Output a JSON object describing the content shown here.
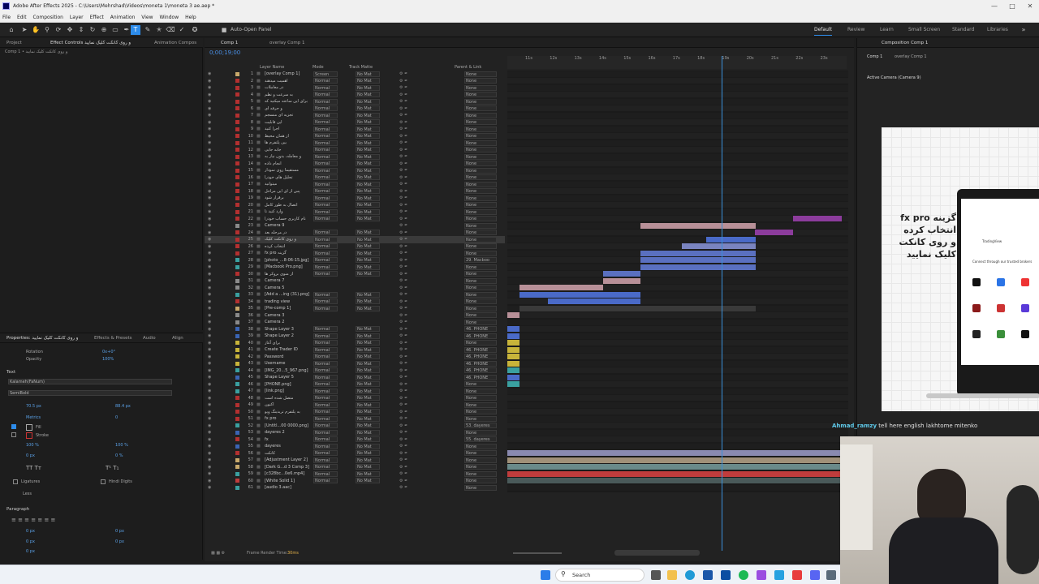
{
  "window": {
    "title": "Adobe After Effects 2025 - C:\\Users\\Mehrshad\\Videos\\moneta 1\\moneta 3 ae.aep *"
  },
  "menu": [
    "File",
    "Edit",
    "Composition",
    "Layer",
    "Effect",
    "Animation",
    "View",
    "Window",
    "Help"
  ],
  "toolbar": {
    "auto_open": "Auto-Open Panel"
  },
  "workspaces": [
    "Default",
    "Review",
    "Learn",
    "Small Screen",
    "Standard",
    "Libraries"
  ],
  "project_panel": {
    "tab_project": "Project",
    "tab_effects": "Effect Controls و روی کانکت کلیک نمایید",
    "tab_anim": "Animation Compos",
    "subtitle": "Comp 1 • و روی کانکت کلیک نمایید"
  },
  "timeline": {
    "tabs": [
      "Comp 1",
      "overlay Comp 1"
    ],
    "timecode": "0;00;19;00",
    "col_layer": "Layer Name",
    "col_mode": "Mode",
    "col_track": "Track Matte",
    "col_parent": "Parent & Link",
    "ruler": [
      "11s",
      "12s",
      "13s",
      "14s",
      "15s",
      "16s",
      "17s",
      "18s",
      "19s",
      "20s",
      "21s",
      "22s",
      "23s"
    ],
    "footer": "Frame Render Time:",
    "footer_val": "30ms"
  },
  "layers": [
    {
      "n": "1",
      "name": "[overlay Comp 1]",
      "mode": "Screen",
      "matte": "No Mat",
      "parent": "None",
      "color": "#c8a96b"
    },
    {
      "n": "2",
      "name": "اهمیت میدهند",
      "mode": "Normal",
      "matte": "No Mat",
      "parent": "None",
      "color": "#b33030"
    },
    {
      "n": "3",
      "name": "در معاملات",
      "mode": "Normal",
      "matte": "No Mat",
      "parent": "None",
      "color": "#b33030"
    },
    {
      "n": "4",
      "name": "به سرعت و نظم",
      "mode": "Normal",
      "matte": "No Mat",
      "parent": "None",
      "color": "#b33030"
    },
    {
      "n": "5",
      "name": "برای این ساعته میکنید که",
      "mode": "Normal",
      "matte": "No Mat",
      "parent": "None",
      "color": "#b33030"
    },
    {
      "n": "6",
      "name": "و حرفه ای",
      "mode": "Normal",
      "matte": "No Mat",
      "parent": "None",
      "color": "#b33030"
    },
    {
      "n": "7",
      "name": "تجزیه ای منسجم",
      "mode": "Normal",
      "matte": "No Mat",
      "parent": "None",
      "color": "#b33030"
    },
    {
      "n": "8",
      "name": "این قابلیت",
      "mode": "Normal",
      "matte": "No Mat",
      "parent": "None",
      "color": "#b33030"
    },
    {
      "n": "9",
      "name": "اجرا کنید",
      "mode": "Normal",
      "matte": "No Mat",
      "parent": "None",
      "color": "#b33030"
    },
    {
      "n": "10",
      "name": "از همان محیط",
      "mode": "Normal",
      "matte": "No Mat",
      "parent": "None",
      "color": "#b33030"
    },
    {
      "n": "11",
      "name": "بین پلتفرم ها",
      "mode": "Normal",
      "matte": "No Mat",
      "parent": "None",
      "color": "#b33030"
    },
    {
      "n": "12",
      "name": "جابه جایی",
      "mode": "Normal",
      "matte": "No Mat",
      "parent": "None",
      "color": "#b33030"
    },
    {
      "n": "13",
      "name": "و معامله، بدون نیاز به",
      "mode": "Normal",
      "matte": "No Mat",
      "parent": "None",
      "color": "#b33030"
    },
    {
      "n": "14",
      "name": "انجام داده",
      "mode": "Normal",
      "matte": "No Mat",
      "parent": "None",
      "color": "#b33030"
    },
    {
      "n": "15",
      "name": "مستقیما روی نمودار",
      "mode": "Normal",
      "matte": "No Mat",
      "parent": "None",
      "color": "#b33030"
    },
    {
      "n": "16",
      "name": "تحلیل های خودرا",
      "mode": "Normal",
      "matte": "No Mat",
      "parent": "None",
      "color": "#b33030"
    },
    {
      "n": "17",
      "name": "میتوانید",
      "mode": "Normal",
      "matte": "No Mat",
      "parent": "None",
      "color": "#b33030"
    },
    {
      "n": "18",
      "name": "پس از ای این مراحل",
      "mode": "Normal",
      "matte": "No Mat",
      "parent": "None",
      "color": "#b33030"
    },
    {
      "n": "19",
      "name": "برقرار شود",
      "mode": "Normal",
      "matte": "No Mat",
      "parent": "None",
      "color": "#b33030"
    },
    {
      "n": "20",
      "name": "اتصال به طور کامل",
      "mode": "Normal",
      "matte": "No Mat",
      "parent": "None",
      "color": "#b33030"
    },
    {
      "n": "21",
      "name": "وارد کنید تا",
      "mode": "Normal",
      "matte": "No Mat",
      "parent": "None",
      "color": "#b33030"
    },
    {
      "n": "22",
      "name": "نام کاربری حساب خودرا",
      "mode": "Normal",
      "matte": "No Mat",
      "parent": "None",
      "color": "#b33030"
    },
    {
      "n": "23",
      "name": "Camera 9",
      "mode": "",
      "matte": "",
      "parent": "None",
      "color": "#8a8a8a"
    },
    {
      "n": "24",
      "name": "در مرحله بعد",
      "mode": "Normal",
      "matte": "No Mat",
      "parent": "None",
      "color": "#b33030"
    },
    {
      "n": "25",
      "name": "و روی کانکت کلیک",
      "mode": "Normal",
      "matte": "No Mat",
      "parent": "None",
      "color": "#b33030"
    },
    {
      "n": "26",
      "name": "انتخاب کرده",
      "mode": "Normal",
      "matte": "No Mat",
      "parent": "None",
      "color": "#b33030"
    },
    {
      "n": "27",
      "name": "fx pro گزینه",
      "mode": "Normal",
      "matte": "No Mat",
      "parent": "None",
      "color": "#b33030"
    },
    {
      "n": "28",
      "name": "[photo_...8-06-15.jpg]",
      "mode": "Normal",
      "matte": "No Mat",
      "parent": "29. Macboo",
      "color": "#3aa0a0"
    },
    {
      "n": "29",
      "name": "[Macbook Pro.png]",
      "mode": "Normal",
      "matte": "No Mat",
      "parent": "None",
      "color": "#3aa0a0"
    },
    {
      "n": "30",
      "name": "از منوی بروکر ها",
      "mode": "Normal",
      "matte": "No Mat",
      "parent": "None",
      "color": "#b33030"
    },
    {
      "n": "31",
      "name": "Camera 7",
      "mode": "",
      "matte": "",
      "parent": "None",
      "color": "#8a8a8a"
    },
    {
      "n": "32",
      "name": "Camera 5",
      "mode": "",
      "matte": "",
      "parent": "None",
      "color": "#8a8a8a"
    },
    {
      "n": "33",
      "name": "[Add a ...ing (31).png]",
      "mode": "Normal",
      "matte": "No Mat",
      "parent": "None",
      "color": "#3aa0a0"
    },
    {
      "n": "34",
      "name": "trading view",
      "mode": "Normal",
      "matte": "No Mat",
      "parent": "None",
      "color": "#b33030"
    },
    {
      "n": "35",
      "name": "[Pre-comp 1]",
      "mode": "Normal",
      "matte": "No Mat",
      "parent": "None",
      "color": "#c8a96b"
    },
    {
      "n": "36",
      "name": "Camera 3",
      "mode": "",
      "matte": "",
      "parent": "None",
      "color": "#8a8a8a"
    },
    {
      "n": "37",
      "name": "Camera 2",
      "mode": "",
      "matte": "",
      "parent": "None",
      "color": "#8a8a8a"
    },
    {
      "n": "38",
      "name": "Shape Layer 3",
      "mode": "Normal",
      "matte": "No Mat",
      "parent": "46. PHONE_",
      "color": "#3a64b4"
    },
    {
      "n": "39",
      "name": "Shape Layer 2",
      "mode": "Normal",
      "matte": "No Mat",
      "parent": "46. PHONE_",
      "color": "#3a64b4"
    },
    {
      "n": "40",
      "name": "برای آغاز",
      "mode": "Normal",
      "matte": "No Mat",
      "parent": "None",
      "color": "#c8b43a"
    },
    {
      "n": "41",
      "name": "Create Trader ID",
      "mode": "Normal",
      "matte": "No Mat",
      "parent": "46. PHONE_",
      "color": "#c8b43a"
    },
    {
      "n": "42",
      "name": "Password",
      "mode": "Normal",
      "matte": "No Mat",
      "parent": "46. PHONE_",
      "color": "#c8b43a"
    },
    {
      "n": "43",
      "name": "Username",
      "mode": "Normal",
      "matte": "No Mat",
      "parent": "46. PHONE_",
      "color": "#c8b43a"
    },
    {
      "n": "44",
      "name": "[IMG_20...5_967.png]",
      "mode": "Normal",
      "matte": "No Mat",
      "parent": "46. PHONE_",
      "color": "#3aa0a0"
    },
    {
      "n": "45",
      "name": "Shape Layer 5",
      "mode": "Normal",
      "matte": "No Mat",
      "parent": "46. PHONE_",
      "color": "#3a64b4"
    },
    {
      "n": "46",
      "name": "[PHONE.png]",
      "mode": "Normal",
      "matte": "No Mat",
      "parent": "None",
      "color": "#3aa0a0"
    },
    {
      "n": "47",
      "name": "[link.png]",
      "mode": "Normal",
      "matte": "No Mat",
      "parent": "None",
      "color": "#3aa0a0"
    },
    {
      "n": "48",
      "name": "متصل شده است",
      "mode": "Normal",
      "matte": "No Mat",
      "parent": "None",
      "color": "#b33030"
    },
    {
      "n": "49",
      "name": "اکنون",
      "mode": "Normal",
      "matte": "No Mat",
      "parent": "None",
      "color": "#b33030"
    },
    {
      "n": "50",
      "name": "به پلتفرم تریدینگ ویو",
      "mode": "Normal",
      "matte": "No Mat",
      "parent": "None",
      "color": "#b33030"
    },
    {
      "n": "51",
      "name": "fx pro",
      "mode": "Normal",
      "matte": "No Mat",
      "parent": "None",
      "color": "#b33030"
    },
    {
      "n": "52",
      "name": "[Untitl...00 0000.png]",
      "mode": "Normal",
      "matte": "No Mat",
      "parent": "53. dayeres",
      "color": "#3aa0a0"
    },
    {
      "n": "53",
      "name": "dayeres 2",
      "mode": "Normal",
      "matte": "No Mat",
      "parent": "None",
      "color": "#3a64b4"
    },
    {
      "n": "54",
      "name": "fx",
      "mode": "Normal",
      "matte": "No Mat",
      "parent": "55. dayeres",
      "color": "#b33030"
    },
    {
      "n": "55",
      "name": "dayeres",
      "mode": "Normal",
      "matte": "No Mat",
      "parent": "None",
      "color": "#3a64b4"
    },
    {
      "n": "56",
      "name": "کانکت",
      "mode": "Normal",
      "matte": "No Mat",
      "parent": "None",
      "color": "#b33030"
    },
    {
      "n": "57",
      "name": "[Adjustment Layer 2]",
      "mode": "Normal",
      "matte": "No Mat",
      "parent": "None",
      "color": "#c8a96b"
    },
    {
      "n": "58",
      "name": "[Dark G...d 3 Comp 3]",
      "mode": "Normal",
      "matte": "No Mat",
      "parent": "None",
      "color": "#c8a96b"
    },
    {
      "n": "59",
      "name": "[c328bc...0e6.mp4]",
      "mode": "Normal",
      "matte": "No Mat",
      "parent": "None",
      "color": "#3aa0a0"
    },
    {
      "n": "60",
      "name": "[White Solid 1]",
      "mode": "Normal",
      "matte": "No Mat",
      "parent": "None",
      "color": "#c03c3c"
    },
    {
      "n": "61",
      "name": "[audio 3.aac]",
      "mode": "",
      "matte": "",
      "parent": "None",
      "color": "#3aa0a0"
    }
  ],
  "properties": {
    "tab": "Properties: و روی کانکت کلیک نمایید",
    "tab2": "Effects & Presets",
    "tab3": "Audio",
    "tab4": "Align",
    "rotation": "Rotation",
    "rotation_val": "0x+0°",
    "opacity": "Opacity",
    "opacity_val": "100%",
    "text_hdr": "Text",
    "font": "Kalameh(FaNum)",
    "style": "SemiBold",
    "size": "70.5 px",
    "leading": "88.4 px",
    "kerning": "Metrics",
    "tracking": "0",
    "fill": "Fill",
    "stroke": "Stroke",
    "scale_v": "100 %",
    "scale_h": "100 %",
    "baseline": "0 px",
    "tsume": "0 %",
    "ligatures": "Ligatures",
    "hindi": "Hindi Digits",
    "less": "Less",
    "paragraph": "Paragraph",
    "p1": "0 px",
    "p2": "0 px",
    "p3": "0 px",
    "p4": "0 px",
    "p5": "0 px"
  },
  "comp_panel": {
    "tab": "Composition Comp 1",
    "bread1": "Comp 1",
    "bread2": "overlay Comp 1",
    "camera": "Active Camera (Camera 9)",
    "text_l1": "fx pro گزینه",
    "text_l2": "انتخاب کرده",
    "text_l3": "و روی کانکت",
    "text_l4": "کلیک نمایید",
    "phone_app": "TradingView",
    "phone_connect": "Connect through our trusted brokers"
  },
  "chat": {
    "user": "Ahmad_ramzy",
    "msg": "tell here english lakhtome mitenko"
  },
  "taskbar": {
    "search": "Search"
  },
  "colors": {
    "accent": "#2d8ceb",
    "playhead": "#3a8fd8",
    "bar_purple": "#8c3c9c",
    "bar_blue": "#4a6ac8",
    "bar_pink": "#b89098"
  }
}
